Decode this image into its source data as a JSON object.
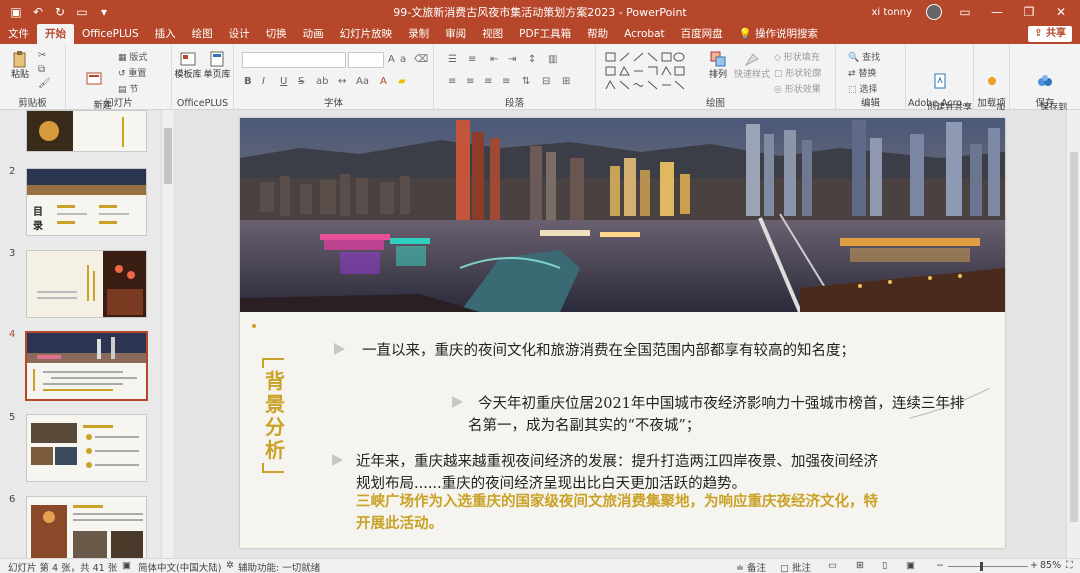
{
  "titlebar": {
    "doc_title": "99-文旅新消费古风夜市集活动策划方案2023 - PowerPoint",
    "user_name": "xi tonny",
    "qa_icons": [
      "save-icon",
      "undo-icon",
      "redo-icon",
      "start-slideshow-icon",
      "customize-icon"
    ]
  },
  "tabs": {
    "items": [
      "文件",
      "开始",
      "OfficePLUS",
      "插入",
      "绘图",
      "设计",
      "切换",
      "动画",
      "幻灯片放映",
      "录制",
      "审阅",
      "视图",
      "PDF工具箱",
      "帮助",
      "Acrobat",
      "百度网盘"
    ],
    "active": "开始",
    "tell_me": "操作说明搜索",
    "share": "共享"
  },
  "ribbon": {
    "clipboard": {
      "label": "剪贴板",
      "paste": "粘贴"
    },
    "slides": {
      "label": "幻灯片",
      "new_slide": "新建\n幻灯片",
      "layout": "版式",
      "reset": "重置",
      "section": "节"
    },
    "officeplus": {
      "label": "OfficePLUS",
      "template_lib": "模板库",
      "single_page_lib": "单页库"
    },
    "font": {
      "label": "字体",
      "bold": "B",
      "italic": "I",
      "underline": "U",
      "strike": "S",
      "shadow": "ab"
    },
    "paragraph": {
      "label": "段落"
    },
    "drawing": {
      "label": "绘图",
      "arrange": "排列",
      "quick_styles": "快速样式",
      "shape_fill": "形状填充",
      "shape_outline": "形状轮廓",
      "shape_effects": "形状效果"
    },
    "editing": {
      "label": "编辑",
      "find": "查找",
      "replace": "替换",
      "select": "选择"
    },
    "adobe": {
      "label": "Adobe Acro...",
      "create_share": "创建并共享\nAdobe PDF"
    },
    "addins": {
      "label": "加载项",
      "addins_btn": "加\n载项"
    },
    "save": {
      "label": "保存",
      "save_baidu": "保存到\n百度网盘"
    }
  },
  "thumbnails": [
    {
      "num": "2",
      "title": "目录"
    },
    {
      "num": "3",
      "title": ""
    },
    {
      "num": "4",
      "title": ""
    },
    {
      "num": "5",
      "title": ""
    },
    {
      "num": "6",
      "title": ""
    }
  ],
  "slide": {
    "side_title": "背景分析",
    "para1": "一直以来，重庆的夜间文化和旅游消费在全国范围内部都享有较高的知名度；",
    "para2": "今天年初重庆位居2021年中国城市夜经济影响力十强城市榜首，连续三年排名第一，成为名副其实的“不夜城”；",
    "para3": "近年来，重庆越来越重视夜间经济的发展：提升打造两江四岸夜景、加强夜间经济规划布局......重庆的夜间经济呈现出比白天更加活跃的趋势。",
    "para4": "三峡广场作为入选重庆的国家级夜间文旅消费集聚地，为响应重庆夜经济文化，特开展此活动。"
  },
  "statusbar": {
    "slide_info": "幻灯片 第 4 张，共 41 张",
    "language": "简体中文(中国大陆)",
    "accessibility": "辅助功能: 一切就绪",
    "notes": "备注",
    "comments": "批注",
    "zoom": "85%"
  },
  "colors": {
    "accent": "#b7472a",
    "gold": "#c9a227"
  }
}
